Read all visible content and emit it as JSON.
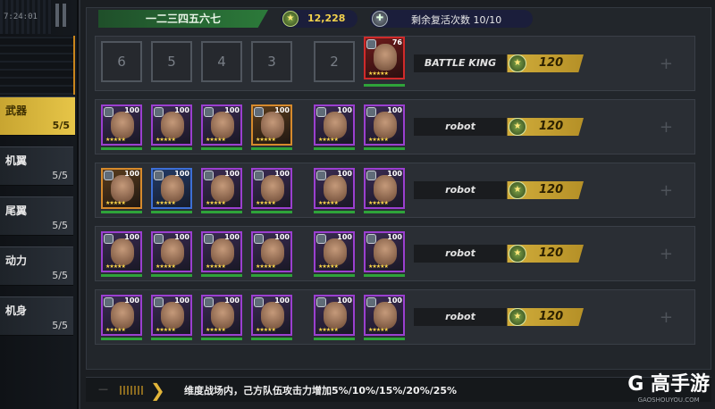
{
  "clock": "7:24:01",
  "team_name": "一二三四五六七",
  "coins": "12,228",
  "revive_text": "剩余复活次数 10/10",
  "sidebar": {
    "tabs": [
      {
        "label": "武器",
        "count": "5/5",
        "active": true
      },
      {
        "label": "机翼",
        "count": "5/5",
        "active": false
      },
      {
        "label": "尾翼",
        "count": "5/5",
        "active": false
      },
      {
        "label": "动力",
        "count": "5/5",
        "active": false
      },
      {
        "label": "机身",
        "count": "5/5",
        "active": false
      }
    ]
  },
  "rows": [
    {
      "empty": [
        "6",
        "5",
        "4",
        "3",
        "2"
      ],
      "name": "BATTLE KING",
      "cost": "120",
      "levels": [
        "76"
      ]
    },
    {
      "name": "robot",
      "cost": "120",
      "levels": [
        "100",
        "100",
        "100",
        "100",
        "100",
        "100"
      ]
    },
    {
      "name": "robot",
      "cost": "120",
      "levels": [
        "100",
        "100",
        "100",
        "100",
        "100",
        "100"
      ]
    },
    {
      "name": "robot",
      "cost": "120",
      "levels": [
        "100",
        "100",
        "100",
        "100",
        "100",
        "100"
      ]
    },
    {
      "name": "robot",
      "cost": "120",
      "levels": [
        "100",
        "100",
        "100",
        "100",
        "100",
        "100"
      ]
    }
  ],
  "footer_text": "维度战场内，己方队伍攻击力增加5%/10%/15%/20%/25%",
  "watermark": {
    "logo": "G 高手游",
    "url": "GAOSHOUYOU.COM"
  },
  "colors": {
    "accent": "#e6c548",
    "team_bar": "#2c7a3a",
    "cost_bar": "#d1ad3b"
  }
}
